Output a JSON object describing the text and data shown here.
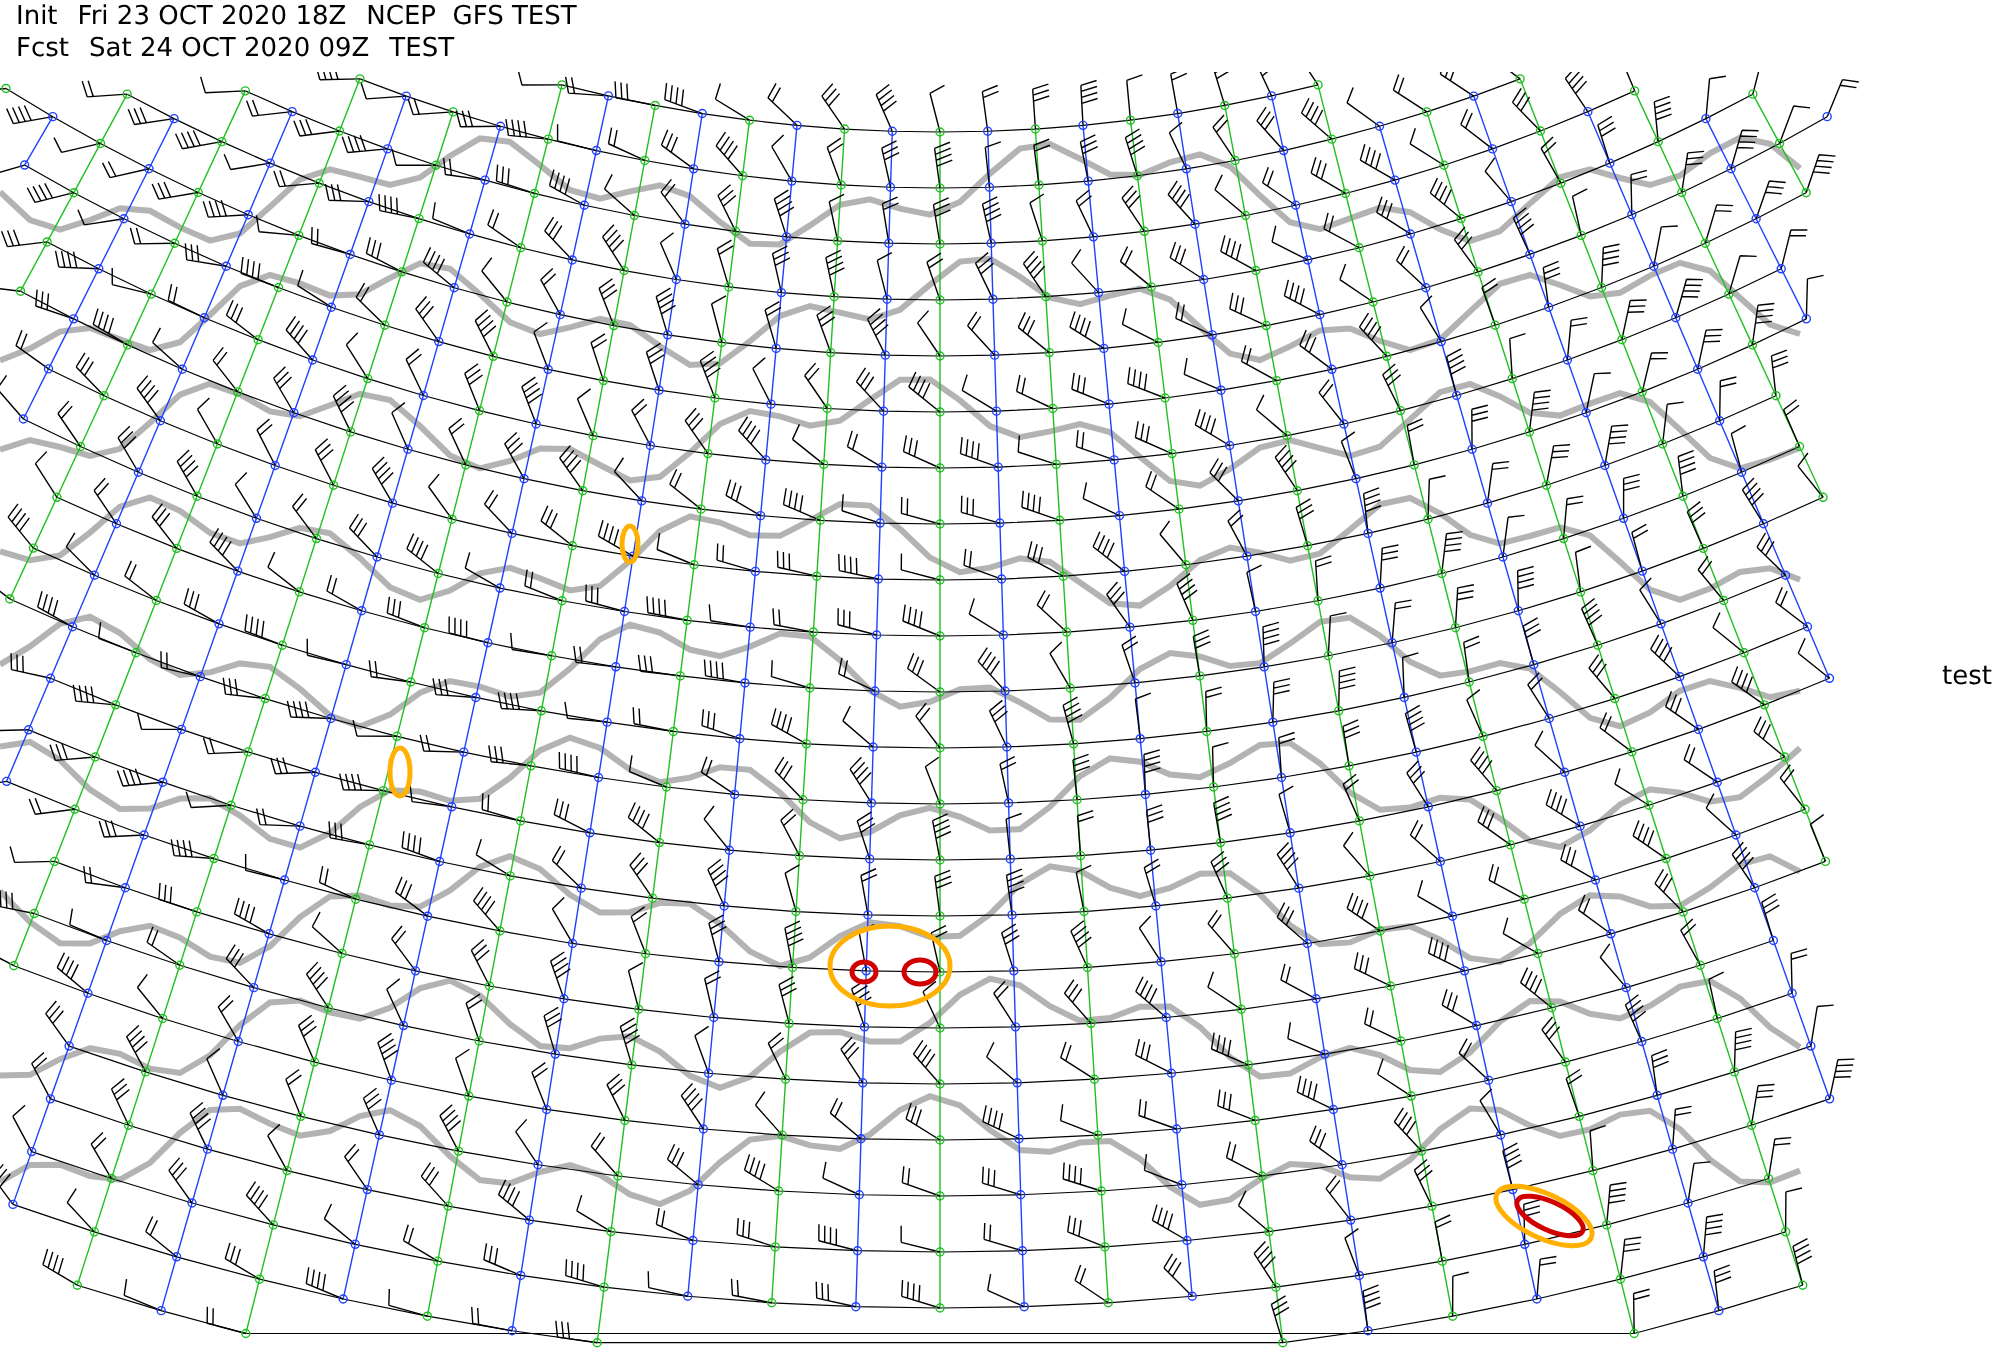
{
  "header": {
    "lines": [
      {
        "label": "Init",
        "time": "Fri 23 OCT 2020 18Z",
        "model": "NCEP  GFS TEST"
      },
      {
        "label": "Fcst",
        "time": "Sat 24 OCT 2020 09Z",
        "model": "TEST"
      }
    ]
  },
  "side_label": "test"
}
